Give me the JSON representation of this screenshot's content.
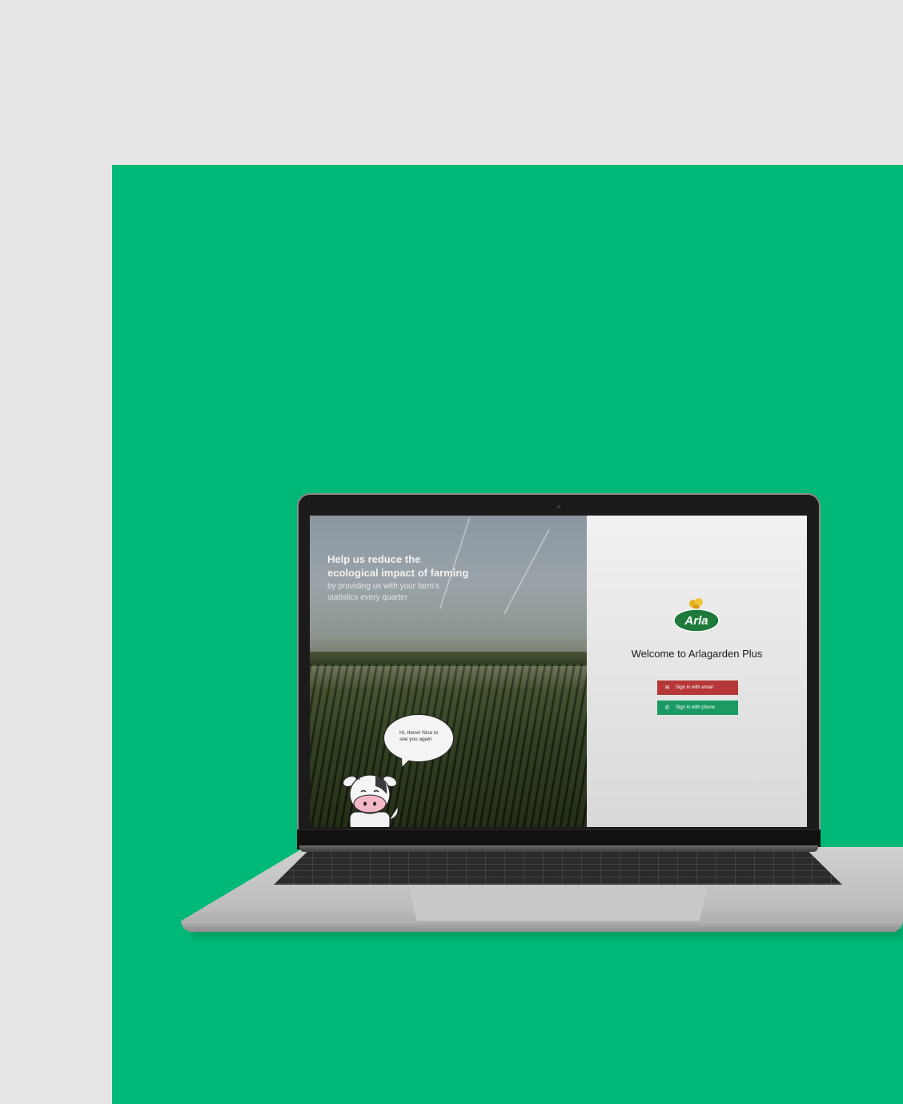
{
  "hero": {
    "title_line1": "Help us reduce the",
    "title_line2": "ecological impact of farming",
    "subtitle_line1": "by providing us with your farm's",
    "subtitle_line2": "statistics every quarter"
  },
  "mascot": {
    "speech": "Hi, there! Nice to see you again"
  },
  "login": {
    "logo_text": "Arla",
    "welcome": "Welcome to Arlagarden Plus",
    "email_button": "Sign in with email",
    "phone_button": "Sign in with phone"
  },
  "colors": {
    "background": "#e6e6e6",
    "brand_green": "#00b877",
    "email_button": "#b53737",
    "phone_button": "#1b9b63"
  },
  "icons": {
    "email": "mail-icon",
    "phone": "phone-icon"
  }
}
